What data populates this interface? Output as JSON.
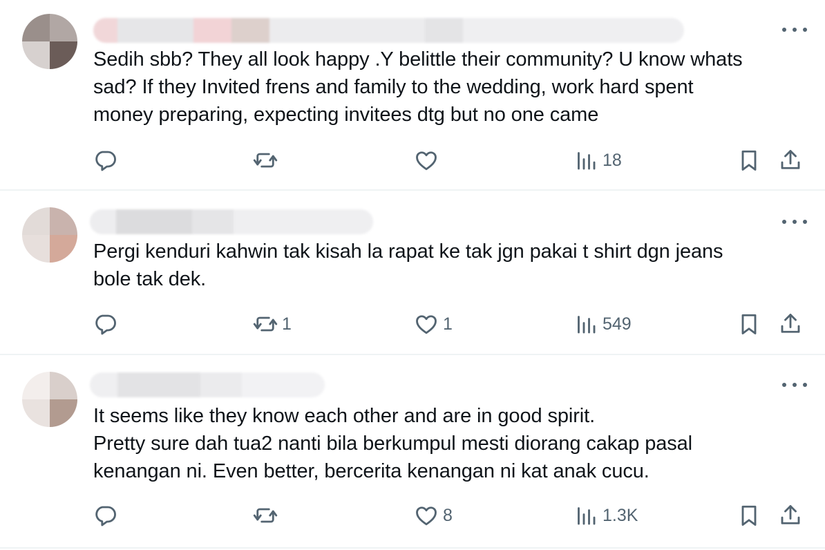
{
  "tweets": [
    {
      "text": "Sedih sbb? They all look happy .Y belittle their community? U know whats\nsad? If they Invited frens and family to the wedding, work hard spent\nmoney preparing, expecting invitees dtg but no one came",
      "replies": "",
      "retweets": "",
      "likes": "",
      "views": "18",
      "avatar_colors": [
        "#9a8f8b",
        "#b1a7a4",
        "#d7d1cf",
        "#6b5c58"
      ]
    },
    {
      "text": "Pergi kenduri kahwin tak kisah la rapat ke tak jgn pakai t shirt dgn jeans\nbole tak dek.",
      "replies": "",
      "retweets": "1",
      "likes": "1",
      "views": "549",
      "avatar_colors": [
        "#e2dbd8",
        "#c9b3ad",
        "#e7dfdc",
        "#d4a99a"
      ]
    },
    {
      "text": "It seems like they know each other and are in good spirit.\nPretty sure dah tua2 nanti bila berkumpul mesti diorang cakap pasal\nkenangan ni. Even better, bercerita kenangan ni kat anak cucu.",
      "replies": "",
      "retweets": "",
      "likes": "8",
      "views": "1.3K",
      "avatar_colors": [
        "#f3eeec",
        "#d9cfcb",
        "#e9e2df",
        "#b29b90"
      ]
    }
  ],
  "icons": {
    "reply": "reply-icon",
    "retweet": "retweet-icon",
    "like": "heart-icon",
    "views": "views-icon",
    "bookmark": "bookmark-icon",
    "share": "share-icon",
    "more": "more-icon"
  },
  "colors": {
    "icon_gray": "#536471",
    "text": "#0f1419",
    "divider": "#eff3f4"
  }
}
